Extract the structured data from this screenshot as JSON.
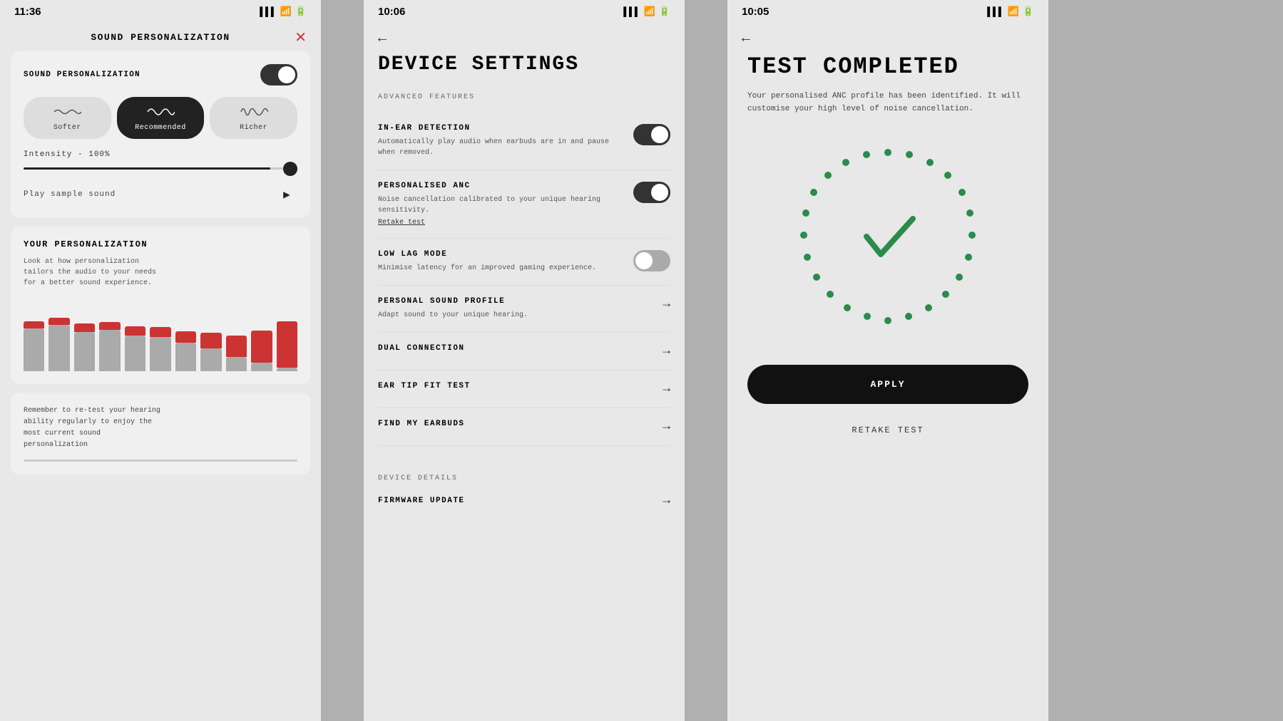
{
  "panel1": {
    "status_time": "11:36",
    "title": "SOUND PERSONALIZATION",
    "close_label": "✕",
    "sound_personalization_label": "SOUND PERSONALIZATION",
    "toggle_on": true,
    "profiles": [
      {
        "id": "softer",
        "label": "Softer",
        "active": false
      },
      {
        "id": "recommended",
        "label": "Recommended",
        "active": true
      },
      {
        "id": "richer",
        "label": "Richer",
        "active": false
      }
    ],
    "intensity_label": "Intensity - 100%",
    "play_label": "Play sample sound",
    "your_personalization_title": "YOUR PERSONALIZATION",
    "your_personalization_desc": "Look at how personalization\ntailors the audio to your needs\nfor a better sound experience.",
    "reminder_text": "Remember to re-test your hearing\nability regularly to enjoy the\nmost current sound\npersonalization",
    "bars": [
      {
        "gray": 60,
        "red": 10
      },
      {
        "gray": 65,
        "red": 10
      },
      {
        "gray": 55,
        "red": 12
      },
      {
        "gray": 58,
        "red": 11
      },
      {
        "gray": 50,
        "red": 13
      },
      {
        "gray": 48,
        "red": 14
      },
      {
        "gray": 42,
        "red": 16
      },
      {
        "gray": 35,
        "red": 20
      },
      {
        "gray": 25,
        "red": 30
      },
      {
        "gray": 15,
        "red": 45
      },
      {
        "gray": 8,
        "red": 60
      }
    ]
  },
  "panel2": {
    "status_time": "10:06",
    "title": "DEVICE SETTINGS",
    "advanced_features_label": "ADVANCED FEATURES",
    "items": [
      {
        "id": "in-ear-detection",
        "title": "IN-EAR DETECTION",
        "desc": "Automatically play audio when earbuds are in and pause when removed.",
        "type": "toggle",
        "toggle_on": true,
        "link": null
      },
      {
        "id": "personalised-anc",
        "title": "PERSONALISED ANC",
        "desc": "Noise cancellation calibrated to your unique hearing sensitivity.",
        "type": "toggle",
        "toggle_on": true,
        "link": "Retake test"
      },
      {
        "id": "low-lag-mode",
        "title": "LOW LAG MODE",
        "desc": "Minimise latency for an improved gaming experience.",
        "type": "toggle",
        "toggle_on": false,
        "link": null
      },
      {
        "id": "personal-sound-profile",
        "title": "PERSONAL SOUND PROFILE",
        "desc": "Adapt sound to your unique hearing.",
        "type": "arrow",
        "link": null
      },
      {
        "id": "dual-connection",
        "title": "DUAL CONNECTION",
        "desc": null,
        "type": "arrow",
        "link": null
      },
      {
        "id": "ear-tip-fit-test",
        "title": "EAR TIP FIT TEST",
        "desc": null,
        "type": "arrow",
        "link": null
      },
      {
        "id": "find-my-earbuds",
        "title": "FIND MY EARBUDS",
        "desc": null,
        "type": "arrow",
        "link": null
      }
    ],
    "device_details_label": "DEVICE DETAILS",
    "firmware_label": "FIRMWARE UPDATE"
  },
  "panel3": {
    "status_time": "10:05",
    "title": "TEST COMPLETED",
    "desc": "Your personalised ANC profile has been identified. It will customise your high level of noise cancellation.",
    "apply_label": "APPLY",
    "retake_label": "RETAKE TEST",
    "check_symbol": "✓"
  },
  "icons": {
    "back_arrow": "←",
    "close": "✕",
    "play": "▶",
    "arrow_right": "→",
    "signal": "▌▌▌",
    "wifi": "⊙",
    "battery": "▓"
  }
}
